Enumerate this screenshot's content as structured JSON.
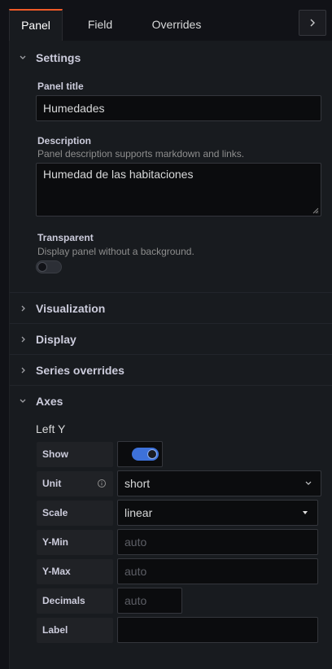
{
  "tabs": {
    "panel": "Panel",
    "field": "Field",
    "overrides": "Overrides"
  },
  "settings": {
    "title": "Settings",
    "panel_title_label": "Panel title",
    "panel_title_value": "Humedades",
    "description_label": "Description",
    "description_help": "Panel description supports markdown and links.",
    "description_value": "Humedad de las habitaciones",
    "transparent_label": "Transparent",
    "transparent_help": "Display panel without a background.",
    "transparent_on": false
  },
  "sections": {
    "visualization": "Visualization",
    "display": "Display",
    "series_overrides": "Series overrides",
    "axes": "Axes"
  },
  "axes": {
    "left_y_title": "Left Y",
    "show_label": "Show",
    "show_on": true,
    "unit_label": "Unit",
    "unit_value": "short",
    "scale_label": "Scale",
    "scale_value": "linear",
    "ymin_label": "Y-Min",
    "ymin_placeholder": "auto",
    "ymax_label": "Y-Max",
    "ymax_placeholder": "auto",
    "decimals_label": "Decimals",
    "decimals_placeholder": "auto",
    "label_label": "Label",
    "label_value": ""
  },
  "colors": {
    "accent": "#f05a28",
    "toggle_on": "#3d71d9",
    "panel_bg": "#181b1f",
    "page_bg": "#111217"
  },
  "icons": {
    "expand": "chevron-right-icon",
    "section_collapsed": "chevron-right-icon",
    "section_expanded": "chevron-down-icon",
    "unit_info": "info-circle-icon",
    "unit_dropdown": "chevron-down-icon",
    "scale_dropdown": "caret-down-icon",
    "resize": "resize-grip-icon"
  }
}
